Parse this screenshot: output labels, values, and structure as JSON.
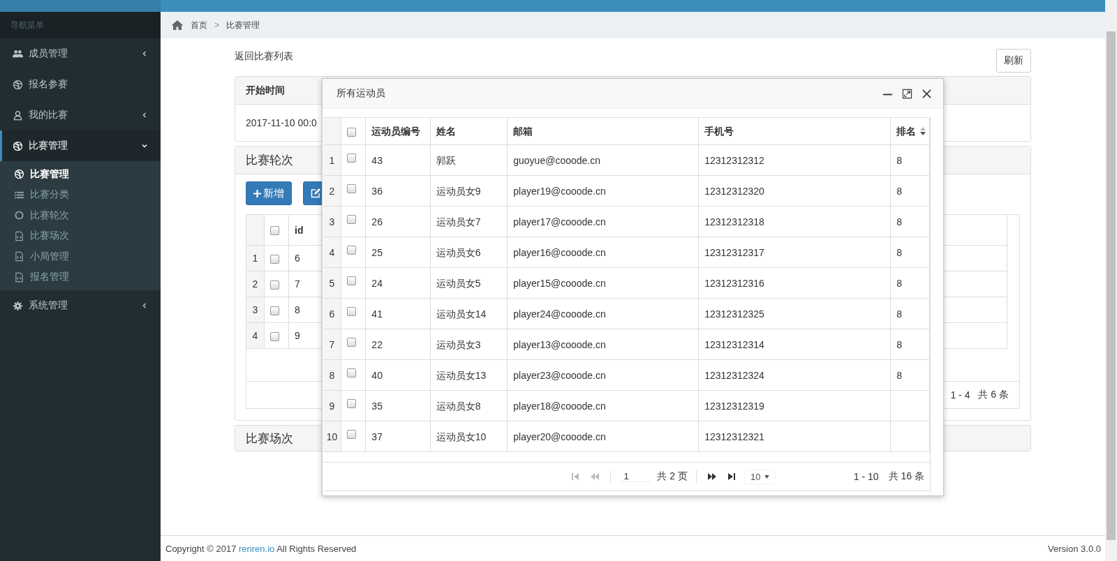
{
  "breadcrumb": {
    "items": [
      "首页",
      "比赛管理"
    ],
    "separator": ">"
  },
  "sidebar": {
    "heading": "导航菜单",
    "items": [
      {
        "label": "成员管理",
        "expanded": false,
        "selected": false
      },
      {
        "label": "报名参赛",
        "selected": false
      },
      {
        "label": "我的比赛",
        "expanded": false,
        "selected": false
      },
      {
        "label": "比赛管理",
        "expanded": true,
        "selected": true,
        "children": [
          {
            "label": "比赛管理",
            "selected": true
          },
          {
            "label": "比赛分类",
            "selected": false
          },
          {
            "label": "比赛轮次",
            "selected": false
          },
          {
            "label": "比赛场次",
            "selected": false
          },
          {
            "label": "小局管理",
            "selected": false
          },
          {
            "label": "报名管理",
            "selected": false
          }
        ]
      },
      {
        "label": "系统管理",
        "expanded": false,
        "selected": false
      }
    ]
  },
  "back_link": "返回比赛列表",
  "refresh_button": "刷新",
  "info_panel": {
    "header": "开始时间",
    "value": "2017-11-10 00:0"
  },
  "rounds_panel": {
    "title": "比赛轮次",
    "add_button": "新增",
    "table": {
      "header_checked": false,
      "column": "id",
      "rows": [
        {
          "number": "1",
          "checked": false,
          "id": "6"
        },
        {
          "number": "2",
          "checked": false,
          "id": "7"
        },
        {
          "number": "3",
          "checked": false,
          "id": "8"
        },
        {
          "number": "4",
          "checked": false,
          "id": "9"
        }
      ],
      "range": "1 - 4",
      "total": "共 6 条"
    }
  },
  "matches_panel": {
    "title": "比赛场次"
  },
  "modal": {
    "title": "所有运动员",
    "table": {
      "header_checked": false,
      "columns": [
        {
          "label": "运动员编号",
          "sortable": false
        },
        {
          "label": "姓名",
          "sortable": false
        },
        {
          "label": "邮箱",
          "sortable": false
        },
        {
          "label": "手机号",
          "sortable": false
        },
        {
          "label": "排名",
          "sortable": true
        }
      ],
      "rows": [
        {
          "number": "1",
          "checked": false,
          "cells": [
            "43",
            "郭跃",
            "guoyue@cooode.cn",
            "12312312312",
            "8"
          ]
        },
        {
          "number": "2",
          "checked": false,
          "cells": [
            "36",
            "运动员女9",
            "player19@cooode.cn",
            "12312312320",
            "8"
          ]
        },
        {
          "number": "3",
          "checked": false,
          "cells": [
            "26",
            "运动员女7",
            "player17@cooode.cn",
            "12312312318",
            "8"
          ]
        },
        {
          "number": "4",
          "checked": false,
          "cells": [
            "25",
            "运动员女6",
            "player16@cooode.cn",
            "12312312317",
            "8"
          ]
        },
        {
          "number": "5",
          "checked": false,
          "cells": [
            "24",
            "运动员女5",
            "player15@cooode.cn",
            "12312312316",
            "8"
          ]
        },
        {
          "number": "6",
          "checked": false,
          "cells": [
            "41",
            "运动员女14",
            "player24@cooode.cn",
            "12312312325",
            "8"
          ]
        },
        {
          "number": "7",
          "checked": false,
          "cells": [
            "22",
            "运动员女3",
            "player13@cooode.cn",
            "12312312314",
            "8"
          ]
        },
        {
          "number": "8",
          "checked": false,
          "cells": [
            "40",
            "运动员女13",
            "player23@cooode.cn",
            "12312312324",
            "8"
          ]
        },
        {
          "number": "9",
          "checked": false,
          "cells": [
            "35",
            "运动员女8",
            "player18@cooode.cn",
            "12312312319"
          ]
        },
        {
          "number": "10",
          "checked": false,
          "cells": [
            "37",
            "运动员女10",
            "player20@cooode.cn",
            "12312312321"
          ]
        }
      ]
    },
    "pager": {
      "nav": [
        {
          "kind": "first",
          "disabled": true
        },
        {
          "kind": "prev",
          "disabled": true
        },
        {
          "kind": "next",
          "disabled": false
        },
        {
          "kind": "last",
          "disabled": false
        }
      ],
      "page": "1",
      "pages": "共 2 页",
      "page_size": "10",
      "range": "1 - 10",
      "total": "共 16 条"
    }
  },
  "footer": {
    "copyright": "Copyright © 2017",
    "link": "renren.io",
    "rights": "All Rights Reserved",
    "version": "Version 3.0.0"
  }
}
